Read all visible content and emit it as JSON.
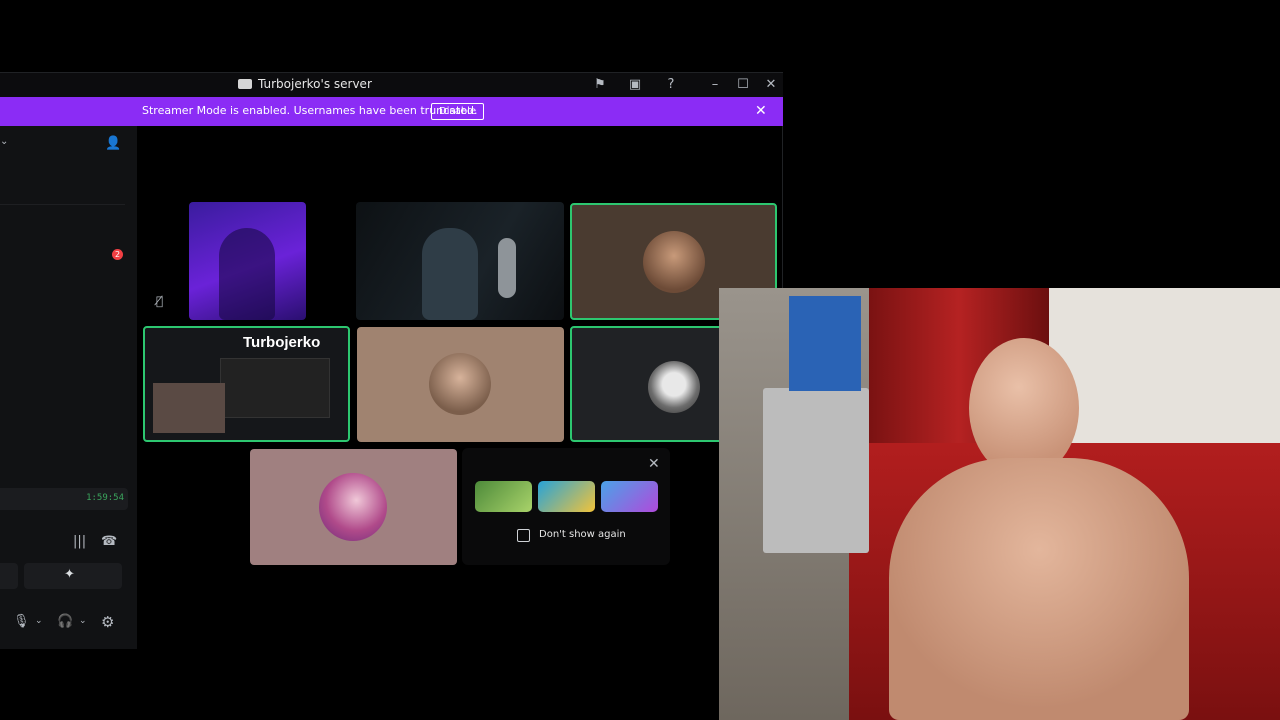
{
  "window": {
    "title": "Turbojerko's server",
    "controls": [
      "minimize",
      "maximize",
      "close"
    ]
  },
  "banner": {
    "message": "Streamer Mode is enabled. Usernames have been truncated.",
    "disable_label": "Disable"
  },
  "sidebar": {
    "notification_count": "2",
    "call_timer": "1:59:54"
  },
  "stage": {
    "tiles": [
      {
        "kind": "video",
        "muted": true
      },
      {
        "kind": "video"
      },
      {
        "kind": "avatar",
        "speaking": true
      },
      {
        "kind": "screen-share",
        "label": "Turbojerko",
        "speaking": true
      },
      {
        "kind": "avatar"
      },
      {
        "kind": "avatar",
        "speaking": true
      },
      {
        "kind": "avatar"
      }
    ]
  },
  "activity_promo": {
    "dont_show_again_label": "Don't show again"
  },
  "colors": {
    "accent": "#8b2cf5",
    "speaking": "#2dc770",
    "badge": "#f23f43",
    "timer": "#3ba55d"
  }
}
